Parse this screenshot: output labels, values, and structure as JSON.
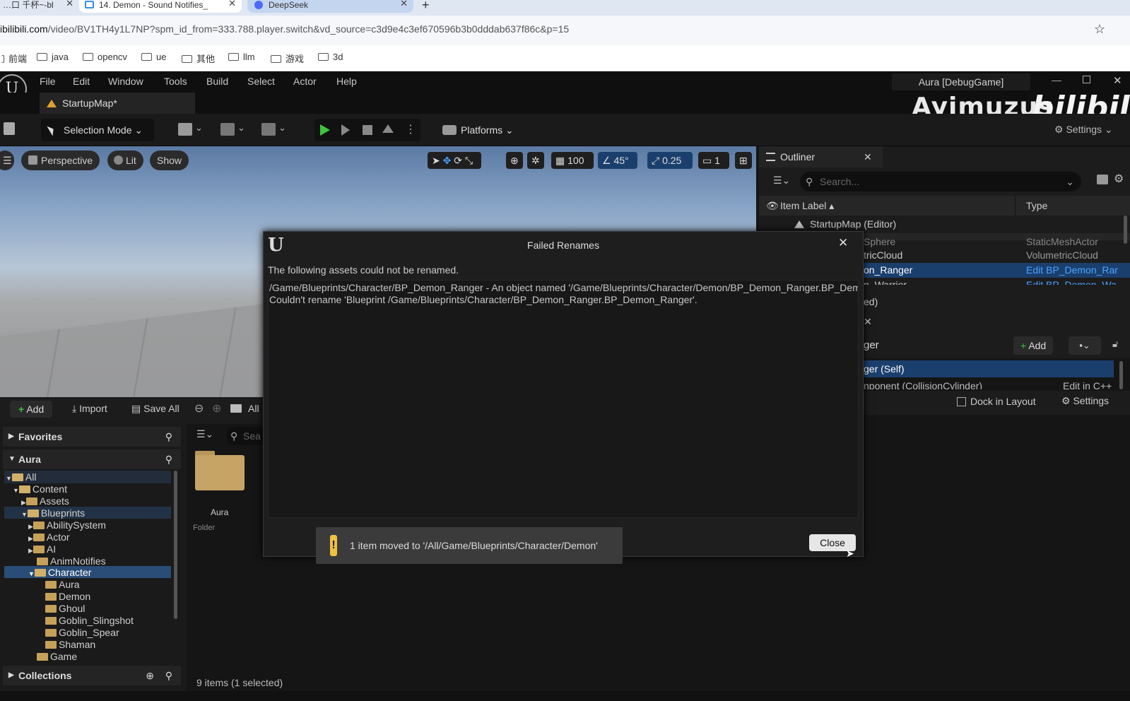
{
  "browser": {
    "tabs": [
      {
        "label": "…口 千杯~-bl"
      },
      {
        "label": "14. Demon - Sound Notifies_"
      },
      {
        "label": "DeepSeek"
      }
    ],
    "url_domain": "bilibili.com",
    "url_rest": "/video/BV1TH4y1L7NP?spm_id_from=333.788.player.switch&vd_source=c3d9e4c3ef670596b3b0dddab637f86c&p=15",
    "url_prefix": "i",
    "bookmarks": [
      "前端",
      "java",
      "opencv",
      "ue",
      "其他",
      "llm",
      "游戏",
      "3d"
    ]
  },
  "ue": {
    "menu": [
      "File",
      "Edit",
      "Window",
      "Tools",
      "Build",
      "Select",
      "Actor",
      "Help"
    ],
    "project_title": "Aura [DebugGame]",
    "map_tab": "StartupMap*",
    "toolbar": {
      "mode": "Selection Mode",
      "platforms": "Platforms",
      "settings": "Settings"
    },
    "watermark_left": "Ayimuzus",
    "watermark_right": "bilibili",
    "viewport": {
      "perspective": "Perspective",
      "lit": "Lit",
      "show": "Show",
      "grid": "100",
      "angle": "45°",
      "scale": "0.25",
      "cam": "1"
    },
    "outliner": {
      "title": "Outliner",
      "search_placeholder": "Search...",
      "col_label": "Item Label",
      "col_type": "Type",
      "rows": [
        {
          "label": "StartupMap (Editor)",
          "type": ""
        },
        {
          "label": "Sphere",
          "type": "StaticMeshActor"
        },
        {
          "label": "tricCloud",
          "type": "VolumetricCloud"
        },
        {
          "label": "on_Ranger",
          "type": "Edit BP_Demon_Rar"
        },
        {
          "label": "n_Warrior",
          "type": "Edit BP_Demon_Wa"
        }
      ],
      "footer": "ed)"
    },
    "details": {
      "name_partial": "ger",
      "add_label": "Add",
      "self_row": "ger (Self)",
      "component_row": "nponent (CollisionCylinder)",
      "component_edit": "Edit in C++",
      "dock": "Dock in Layout",
      "settings": "Settings"
    },
    "content_browser": {
      "add": "Add",
      "import": "Import",
      "save_all": "Save All",
      "path": "All",
      "search_partial": "Sea",
      "favorites": "Favorites",
      "root": "Aura",
      "collections": "Collections",
      "tree": [
        {
          "label": "All",
          "depth": 0
        },
        {
          "label": "Content",
          "depth": 1
        },
        {
          "label": "Assets",
          "depth": 2
        },
        {
          "label": "Blueprints",
          "depth": 2
        },
        {
          "label": "AbilitySystem",
          "depth": 3
        },
        {
          "label": "Actor",
          "depth": 3
        },
        {
          "label": "AI",
          "depth": 3
        },
        {
          "label": "AnimNotifies",
          "depth": 3
        },
        {
          "label": "Character",
          "depth": 3
        },
        {
          "label": "Aura",
          "depth": 4
        },
        {
          "label": "Demon",
          "depth": 4
        },
        {
          "label": "Ghoul",
          "depth": 4
        },
        {
          "label": "Goblin_Slingshot",
          "depth": 4
        },
        {
          "label": "Goblin_Spear",
          "depth": 4
        },
        {
          "label": "Shaman",
          "depth": 4
        },
        {
          "label": "Game",
          "depth": 3
        }
      ],
      "asset_name": "Aura",
      "asset_type": "Folder",
      "item_count": "9 items (1 selected)"
    },
    "dialog": {
      "title": "Failed Renames",
      "message": "The following assets could not be renamed.",
      "line1": "/Game/Blueprints/Character/BP_Demon_Ranger - An object named '/Game/Blueprints/Character/Demon/BP_Demon_Ranger.BP_Demon_Ranger' already exists.",
      "line2": "Couldn't rename 'Blueprint /Game/Blueprints/Character/BP_Demon_Ranger.BP_Demon_Ranger'.",
      "close": "Close"
    },
    "toast": "1 item moved to '/All/Game/Blueprints/Character/Demon'"
  }
}
